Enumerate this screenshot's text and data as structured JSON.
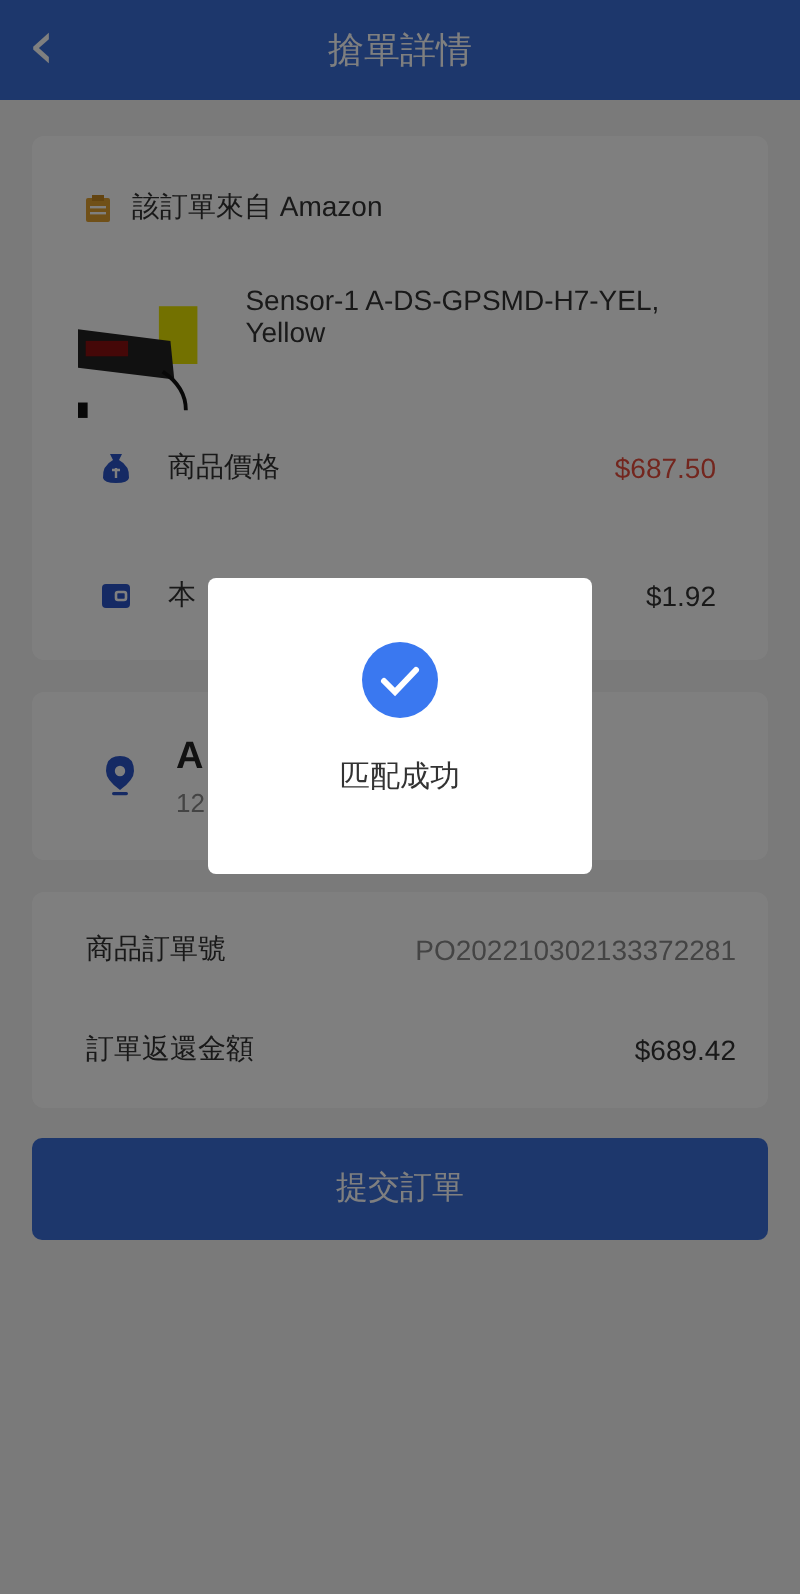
{
  "header": {
    "back": "‹",
    "title": "搶單詳情"
  },
  "order": {
    "source": "該訂單來自 Amazon",
    "product_name": "Sensor-1 A-DS-GPSMD-H7-YEL, Yellow",
    "rows": [
      {
        "kind": "price",
        "label": "商品價格",
        "value": "$687.50"
      },
      {
        "kind": "commission",
        "label": "本",
        "value": "$1.92"
      }
    ]
  },
  "address": {
    "name": "A",
    "line": "12"
  },
  "summary": [
    {
      "label": "商品訂單號",
      "value": "PO202210302133372281"
    },
    {
      "label": "訂單返還金額",
      "value": "$689.42"
    }
  ],
  "submit": "提交訂單",
  "dialog": {
    "visible": true,
    "message": "匹配成功"
  }
}
